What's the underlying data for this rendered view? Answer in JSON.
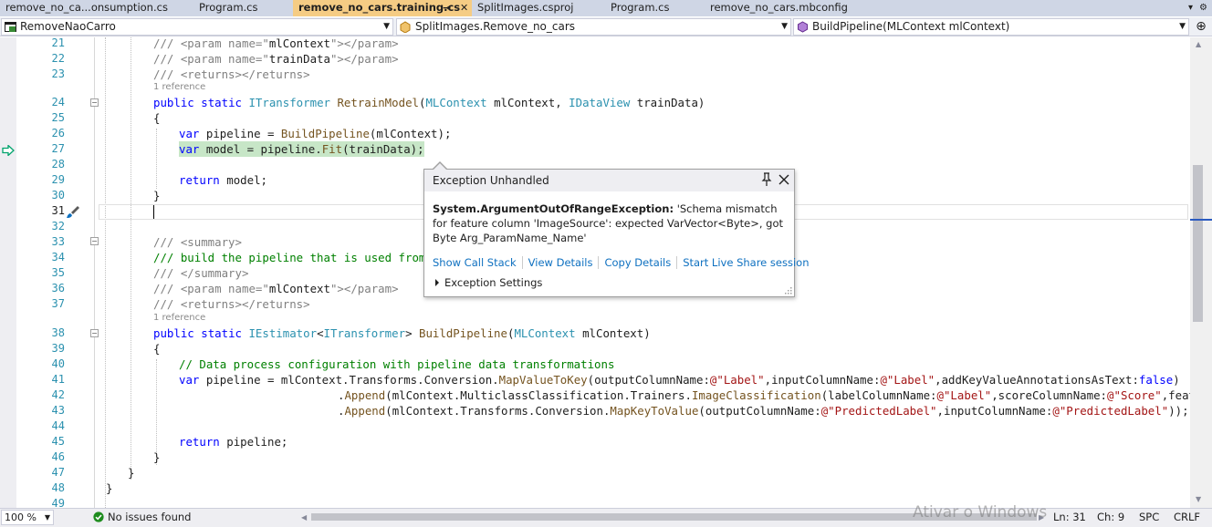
{
  "tabs": [
    {
      "label": "remove_no_ca...onsumption.cs",
      "active": false
    },
    {
      "label": "Program.cs",
      "active": false
    },
    {
      "label": "remove_no_cars.training.cs",
      "active": true
    },
    {
      "label": "SplitImages.csproj",
      "active": false
    },
    {
      "label": "Program.cs",
      "active": false
    },
    {
      "label": "remove_no_cars.mbconfig",
      "active": false
    }
  ],
  "tab_icons": {
    "pin": "pin-icon",
    "close": "close-icon",
    "overflow": "chevron-down-icon",
    "settings": "gear-icon"
  },
  "navbar": {
    "project": "RemoveNaoCarro",
    "type": "SplitImages.Remove_no_cars",
    "member": "BuildPipeline(MLContext mlContext)"
  },
  "line_numbers": [
    "21",
    "22",
    "23",
    "24",
    "25",
    "26",
    "27",
    "28",
    "29",
    "30",
    "31",
    "32",
    "33",
    "34",
    "35",
    "36",
    "37",
    "38",
    "39",
    "40",
    "41",
    "42",
    "43",
    "44",
    "45",
    "46",
    "47",
    "48",
    "49"
  ],
  "codelens": {
    "retrain": "1 reference",
    "build": "1 reference"
  },
  "code": {
    "l21": {
      "a": "/// ",
      "b": "<param name=\"",
      "c": "mlContext",
      "d": "\"></param>"
    },
    "l22": {
      "a": "/// ",
      "b": "<param name=\"",
      "c": "trainData",
      "d": "\"></param>"
    },
    "l23": {
      "a": "/// ",
      "b": "<returns></returns>"
    },
    "l24": {
      "kw1": "public",
      "kw2": "static",
      "t1": "ITransformer",
      "m": "RetrainModel",
      "t2": "MLContext",
      "p1": "mlContext,",
      "t3": "IDataView",
      "p2": "trainData)"
    },
    "l25": "{",
    "l26": {
      "kw": "var",
      "a": "pipeline = ",
      "m": "BuildPipeline",
      "b": "(mlContext);"
    },
    "l27": {
      "kw": "var",
      "a": "model = pipeline.",
      "m": "Fit",
      "b": "(trainData);"
    },
    "l29": {
      "kw": "return",
      "a": "model;"
    },
    "l30": "}",
    "l33": {
      "a": "/// ",
      "b": "<summary>"
    },
    "l34": {
      "a": "/// build the pipeline that is used from m"
    },
    "l35": {
      "a": "/// ",
      "b": "</summary>"
    },
    "l36": {
      "a": "/// ",
      "b": "<param name=\"",
      "c": "mlContext",
      "d": "\"></param>"
    },
    "l37": {
      "a": "/// ",
      "b": "<returns></returns>"
    },
    "l38": {
      "kw1": "public",
      "kw2": "static",
      "t1": "IEstimator",
      "t2": "ITransformer",
      "m": "BuildPipeline",
      "t3": "MLContext",
      "p": "mlContext)"
    },
    "l39": "{",
    "l40": "// Data process configuration with pipeline data transformations",
    "l41": {
      "kw": "var",
      "a": "pipeline = mlContext.Transforms.Conversion.",
      "m": "MapValueToKey",
      "p1": "outputColumnName:",
      "s1": "@\"Label\"",
      "p2": ",inputColumnName:",
      "s2": "@\"Label\"",
      "p3": ",addKeyValueAnnotationsAsText:",
      "kw2": "false",
      "e": ")"
    },
    "l42": {
      "a": ".",
      "m1": "Append",
      "b": "(mlContext.MulticlassClassification.Trainers.",
      "m2": "ImageClassification",
      "p1": "labelColumnName:",
      "s1": "@\"Label\"",
      "p2": ",scoreColumnName:",
      "s2": "@\"Score\"",
      "p3": ",featureC"
    },
    "l43": {
      "a": ".",
      "m1": "Append",
      "b": "(mlContext.Transforms.Conversion.",
      "m2": "MapKeyToValue",
      "p1": "outputColumnName:",
      "s1": "@\"PredictedLabel\"",
      "p2": ",inputColumnName:",
      "s2": "@\"PredictedLabel\"",
      "e": "));"
    },
    "l45": {
      "kw": "return",
      "a": "pipeline;"
    },
    "l46": "}",
    "l47": "}",
    "l48": "}"
  },
  "exception": {
    "title": "Exception Unhandled",
    "exception_type": "System.ArgumentOutOfRangeException:",
    "message": "'Schema mismatch for feature column 'ImageSource': expected VarVector<Byte>, got Byte Arg_ParamName_Name'",
    "links": [
      "Show Call Stack",
      "View Details",
      "Copy Details",
      "Start Live Share session"
    ],
    "settings": "Exception Settings"
  },
  "status": {
    "zoom": "100 %",
    "issues": "No issues found",
    "ln": "Ln: 31",
    "ch": "Ch: 9",
    "spc": "SPC",
    "eol": "CRLF"
  },
  "watermark": "Ativar o Windows",
  "colors": {
    "keyword": "#0000ff",
    "type": "#2b91af",
    "comment": "#008000",
    "string": "#a31515",
    "active_tab": "#f5cc84",
    "link": "#0e70c0",
    "error": "#e51400",
    "highlight": "#c7e6c7"
  }
}
